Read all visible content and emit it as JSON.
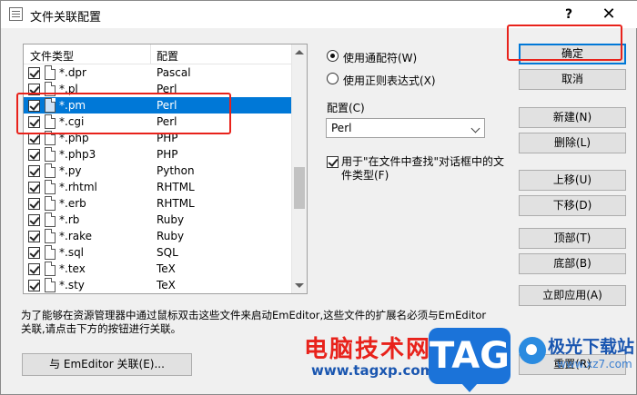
{
  "window": {
    "title": "文件关联配置",
    "help": "?",
    "close": "✕"
  },
  "list": {
    "headers": [
      "文件类型",
      "配置"
    ],
    "rows": [
      {
        "ext": "*.dpr",
        "config": "Pascal",
        "checked": true,
        "selected": false
      },
      {
        "ext": "*.pl",
        "config": "Perl",
        "checked": true,
        "selected": false
      },
      {
        "ext": "*.pm",
        "config": "Perl",
        "checked": true,
        "selected": true
      },
      {
        "ext": "*.cgi",
        "config": "Perl",
        "checked": true,
        "selected": false
      },
      {
        "ext": "*.php",
        "config": "PHP",
        "checked": true,
        "selected": false
      },
      {
        "ext": "*.php3",
        "config": "PHP",
        "checked": true,
        "selected": false
      },
      {
        "ext": "*.py",
        "config": "Python",
        "checked": true,
        "selected": false
      },
      {
        "ext": "*.rhtml",
        "config": "RHTML",
        "checked": true,
        "selected": false
      },
      {
        "ext": "*.erb",
        "config": "RHTML",
        "checked": true,
        "selected": false
      },
      {
        "ext": "*.rb",
        "config": "Ruby",
        "checked": true,
        "selected": false
      },
      {
        "ext": "*.rake",
        "config": "Ruby",
        "checked": true,
        "selected": false
      },
      {
        "ext": "*.sql",
        "config": "SQL",
        "checked": true,
        "selected": false
      },
      {
        "ext": "*.tex",
        "config": "TeX",
        "checked": true,
        "selected": false
      },
      {
        "ext": "*.sty",
        "config": "TeX",
        "checked": true,
        "selected": false
      }
    ]
  },
  "options": {
    "radio_wildcard": "使用通配符(W)",
    "radio_regex": "使用正则表达式(X)",
    "config_label": "配置(C)",
    "config_value": "Perl",
    "find_in_files_check": "用于\"在文件中查找\"对话框中的文件类型(F)"
  },
  "buttons": {
    "ok": "确定",
    "cancel": "取消",
    "new": "新建(N)",
    "delete": "删除(L)",
    "move_up": "上移(U)",
    "move_down": "下移(D)",
    "top": "顶部(T)",
    "bottom": "底部(B)",
    "apply_now": "立即应用(A)",
    "reset": "重置(R)",
    "associate": "与 EmEditor 关联(E)..."
  },
  "description": "为了能够在资源管理器中通过鼠标双击这些文件来启动EmEditor,这些文件的扩展名必须与EmEditor关联,请点击下方的按钮进行关联。",
  "watermark": {
    "site_cn": "电脑技术网",
    "site_url": "www.tagxp.com",
    "tag": "TAG",
    "brand": "极光下载站",
    "brand_url": "www.xz7.com"
  },
  "colors": {
    "selection": "#0078d7",
    "highlight": "#e8221b"
  }
}
